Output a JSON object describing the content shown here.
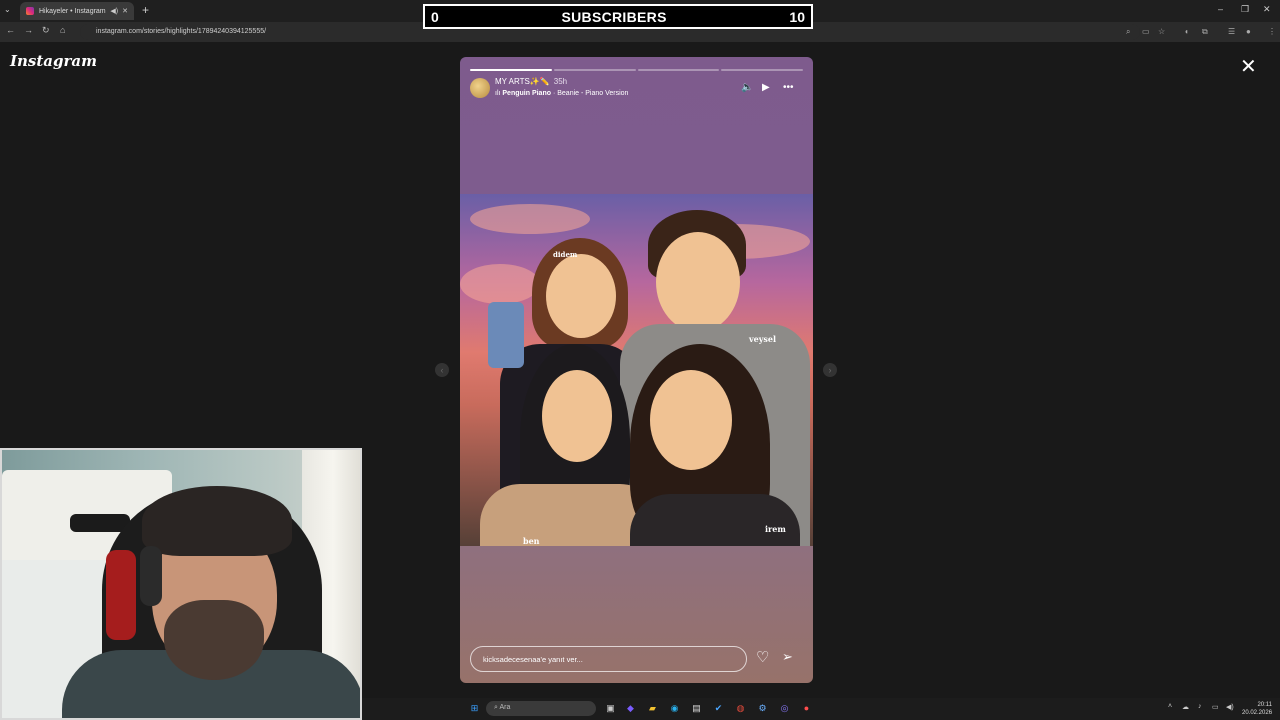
{
  "browser": {
    "tab_title": "Hikayeler • Instagram",
    "url": "instagram.com/stories/highlights/17894240394125555/"
  },
  "overlay": {
    "left_count": "0",
    "label": "SUBSCRIBERS",
    "right_count": "10"
  },
  "page": {
    "brand": "Instagram"
  },
  "story": {
    "title": "MY ARTS✨✏️",
    "time": "35h",
    "music_artist": "Penguin Piano",
    "music_track": " · Beanie - Piano Version",
    "progress_segments": 4,
    "progress_done": 1,
    "art_labels": {
      "didem": "didem",
      "veysel": "veysel",
      "ben": "ben",
      "irem": "irem"
    },
    "reply_placeholder": "kicksadecesenaa'e yanıt ver..."
  },
  "taskbar": {
    "search_placeholder": "Ara",
    "time": "20:11",
    "date": "20.02.2026"
  }
}
